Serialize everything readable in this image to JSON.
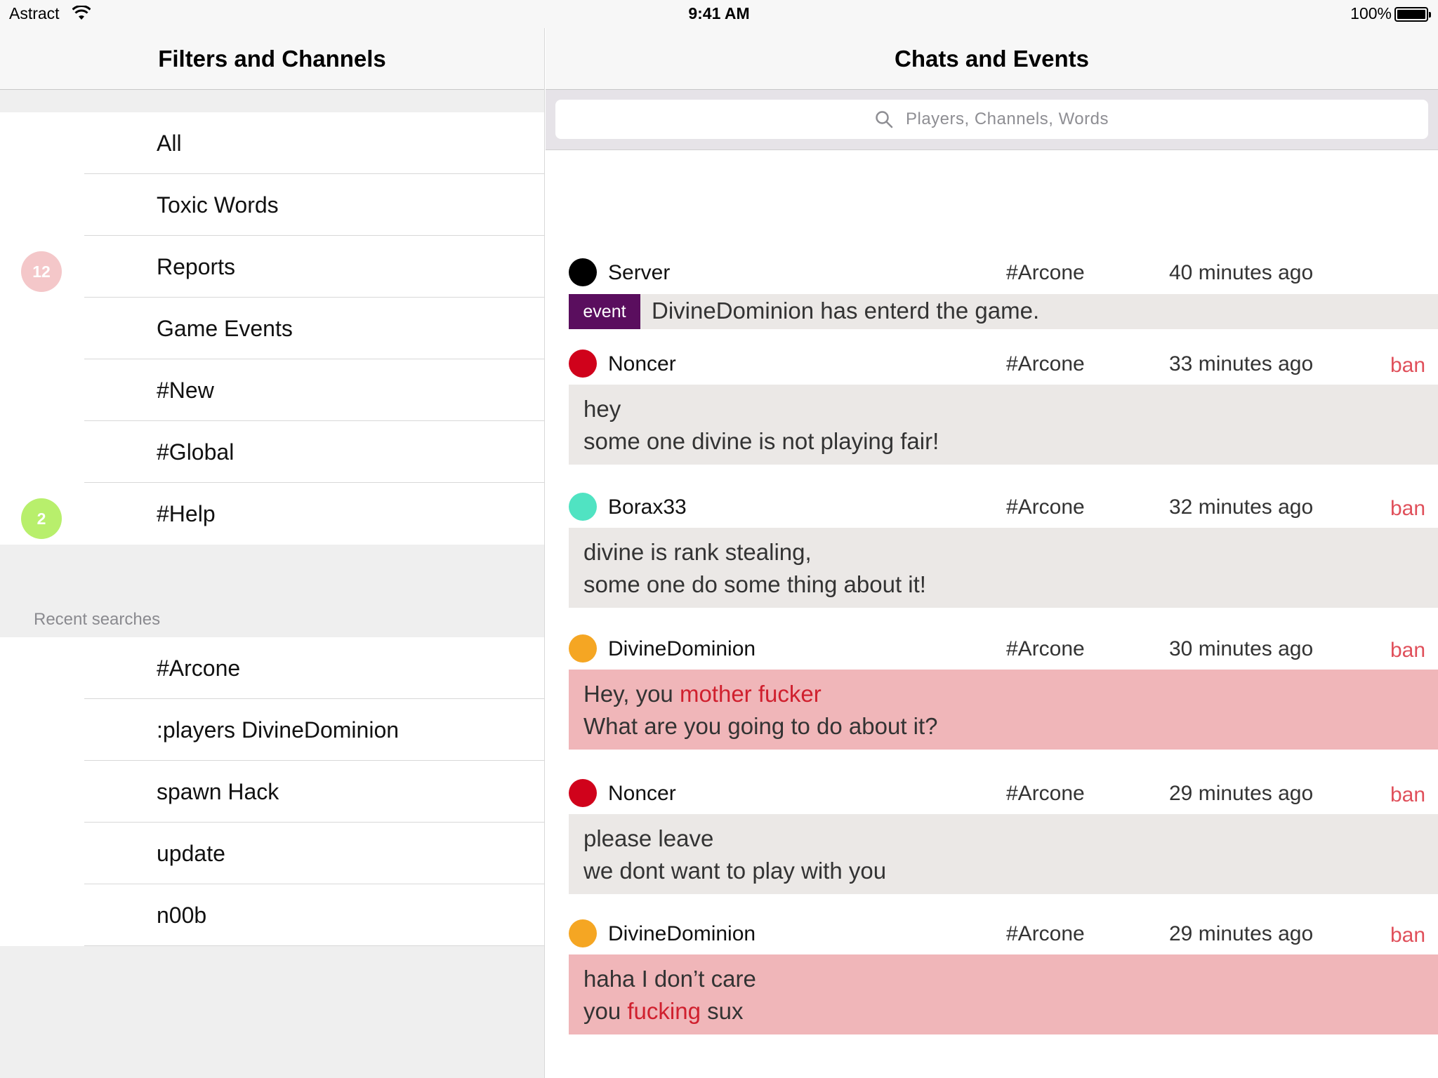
{
  "status_bar": {
    "carrier": "Astract",
    "time": "9:41 AM",
    "battery": "100%"
  },
  "left": {
    "title": "Filters and Channels",
    "filters": [
      {
        "label": "All",
        "badge": "",
        "badge_color": ""
      },
      {
        "label": "Toxic Words",
        "badge": "",
        "badge_color": ""
      },
      {
        "label": "Reports",
        "badge": "12",
        "badge_color": "#f4c7c9"
      },
      {
        "label": "Game Events",
        "badge": "",
        "badge_color": ""
      },
      {
        "label": "#New",
        "badge": "",
        "badge_color": ""
      },
      {
        "label": "#Global",
        "badge": "",
        "badge_color": ""
      },
      {
        "label": "#Help",
        "badge": "2",
        "badge_color": "#b8ef6c"
      }
    ],
    "recent_header": "Recent searches",
    "recent": [
      "#Arcone",
      ":players DivineDominion",
      "spawn Hack",
      "update",
      "n00b"
    ]
  },
  "right": {
    "title": "Chats and Events",
    "search_placeholder": "Players, Channels, Words",
    "ban_label": "ban",
    "event_tag": "event",
    "messages": [
      {
        "user": "Server",
        "dot_color": "#000000",
        "channel": "#Arcone",
        "time": "40 minutes ago",
        "type": "event",
        "line1": "DivineDominion has enterd the game."
      },
      {
        "user": "Noncer",
        "dot_color": "#d0021b",
        "channel": "#Arcone",
        "time": "33 minutes ago",
        "type": "chat",
        "line1": "hey",
        "line2": "some one divine is not playing fair!"
      },
      {
        "user": "Borax33",
        "dot_color": "#50e3c2",
        "channel": "#Arcone",
        "time": "32 minutes ago",
        "type": "chat",
        "line1": "divine is rank stealing,",
        "line2": "some one do some thing about it!"
      },
      {
        "user": "DivineDominion",
        "dot_color": "#f5a623",
        "channel": "#Arcone",
        "time": "30 minutes ago",
        "type": "toxic",
        "line1_pre": "Hey, you ",
        "line1_bad": "mother fucker",
        "line1_post": "",
        "line2": "What are you going to do about it?"
      },
      {
        "user": "Noncer",
        "dot_color": "#d0021b",
        "channel": "#Arcone",
        "time": "29 minutes ago",
        "type": "chat",
        "line1": "please leave",
        "line2": "we dont want to play with you"
      },
      {
        "user": "DivineDominion",
        "dot_color": "#f5a623",
        "channel": "#Arcone",
        "time": "29 minutes ago",
        "type": "toxic2",
        "line1": "haha I don’t care",
        "line2_pre": "you ",
        "line2_bad": "fucking",
        "line2_post": " sux"
      }
    ]
  }
}
